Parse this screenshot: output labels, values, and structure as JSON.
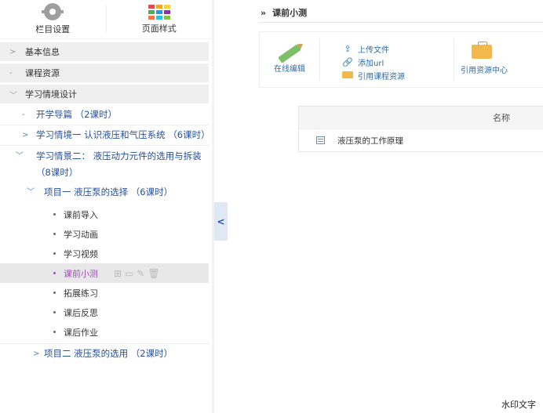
{
  "sidebar": {
    "header": {
      "column_settings": "栏目设置",
      "page_style": "页面样式"
    },
    "sections": [
      {
        "label": "基本信息",
        "arrow": ">"
      },
      {
        "label": "课程资源",
        "arrow": "-"
      },
      {
        "label": "学习情境设计",
        "arrow": "﹀"
      }
    ],
    "items": [
      {
        "label": "开学导篇 （2课时）",
        "arrow": "-"
      },
      {
        "label": "学习情境一 认识液压和气压系统 （6课时）",
        "arrow": ">"
      },
      {
        "label": "学习情景二： 液压动力元件的选用与拆装 （8课时）",
        "arrow": "﹀"
      },
      {
        "label": "项目一 液压泵的选择 （6课时）",
        "arrow": "﹀"
      }
    ],
    "leaves": [
      "课前导入",
      "学习动画",
      "学习视频",
      "课前小测",
      "拓展练习",
      "课后反思",
      "课后作业"
    ],
    "active_leaf_index": 3,
    "project2": {
      "label": "项目二 液压泵的选用 （2课时）",
      "arrow": ">"
    },
    "colors": {
      "link": "#2450a4",
      "active": "#a24db8"
    }
  },
  "collapse_tab": {
    "glyph": "<"
  },
  "main": {
    "breadcrumb": {
      "chevron": "»",
      "title": "课前小测"
    },
    "toolbar": {
      "edit_online": "在线编辑",
      "upload_file": "上传文件",
      "add_url": "添加url",
      "ref_course_resource": "引用课程资源",
      "ref_resource_center": "引用资源中心"
    },
    "table": {
      "header_name": "名称",
      "rows": [
        {
          "name": "液压泵的工作原理"
        }
      ]
    }
  },
  "watermark": "水印文字"
}
